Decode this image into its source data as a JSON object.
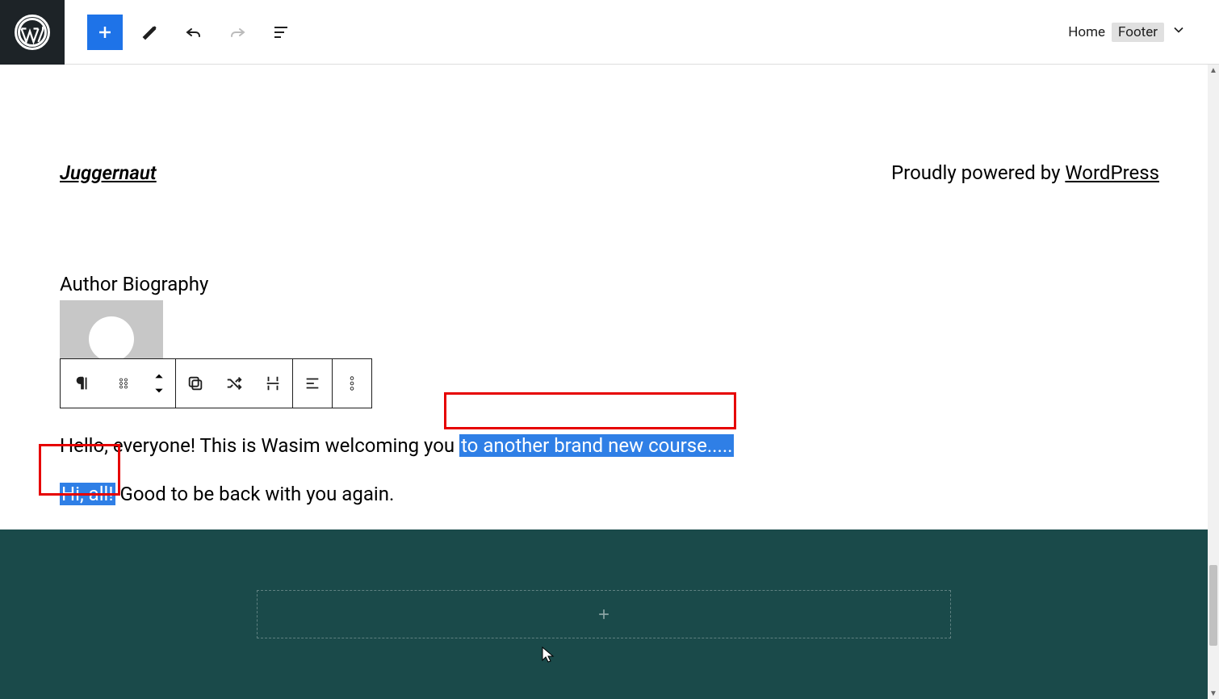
{
  "breadcrumb": {
    "root": "Home",
    "current": "Footer"
  },
  "footer": {
    "site_title": "Juggernaut",
    "powered_prefix": "Proudly powered by ",
    "powered_link": "WordPress"
  },
  "bio": {
    "heading": "Author Biography",
    "para1_prefix": "Hello, everyone! This is Wasim welcoming you ",
    "para1_selected": "to another brand new course.....",
    "para2_selected": "Hi, all!",
    "para2_rest": " Good to be back with you again."
  }
}
